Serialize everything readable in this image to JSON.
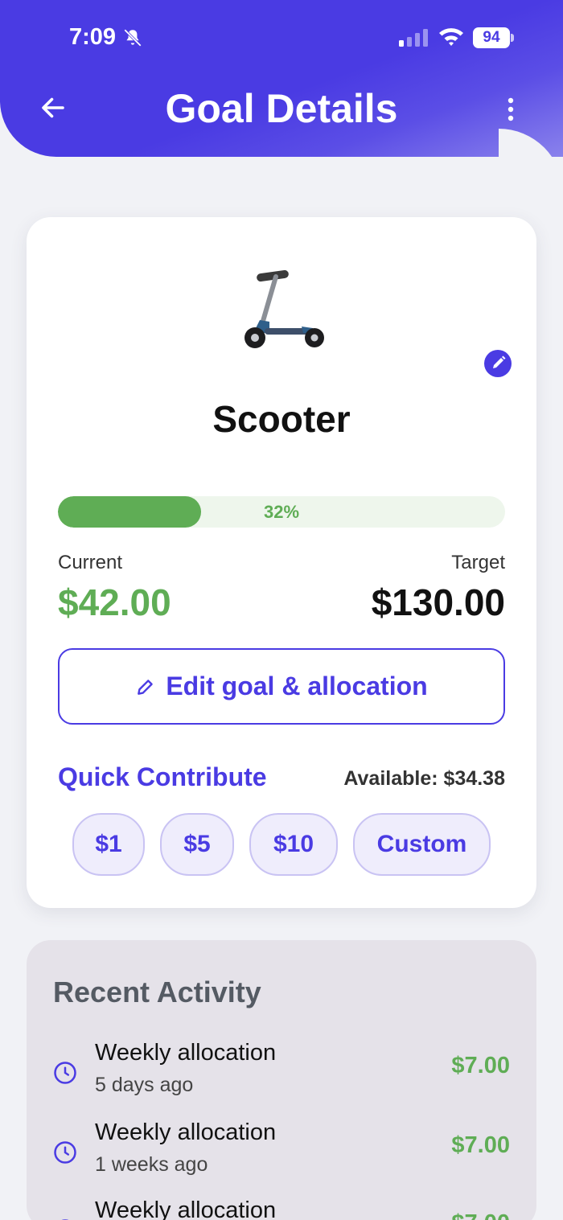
{
  "status_bar": {
    "time": "7:09",
    "battery": "94"
  },
  "header": {
    "title": "Goal Details"
  },
  "goal": {
    "name": "Scooter",
    "progress_percent": 32,
    "progress_label": "32%",
    "current_label": "Current",
    "current_value": "$42.00",
    "target_label": "Target",
    "target_value": "$130.00",
    "edit_button_label": "Edit goal & allocation",
    "icon": "scooter-icon"
  },
  "quick_contribute": {
    "title": "Quick Contribute",
    "available": "Available: $34.38",
    "options": [
      "$1",
      "$5",
      "$10",
      "Custom"
    ]
  },
  "recent_activity": {
    "title": "Recent Activity",
    "items": [
      {
        "title": "Weekly allocation",
        "subtitle": "5 days ago",
        "amount": "$7.00"
      },
      {
        "title": "Weekly allocation",
        "subtitle": "1 weeks ago",
        "amount": "$7.00"
      },
      {
        "title": "Weekly allocation",
        "subtitle": "",
        "amount": "$7.00"
      }
    ]
  },
  "colors": {
    "primary": "#4a3be3",
    "success": "#5fad55",
    "background": "#f1f2f6",
    "activity_bg": "#e5e2e9"
  }
}
